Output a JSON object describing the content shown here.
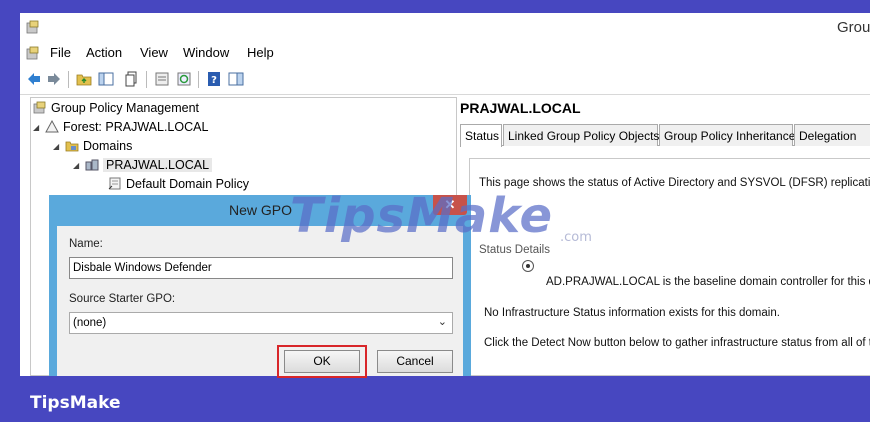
{
  "window": {
    "title": "Grou"
  },
  "menu": [
    "File",
    "Action",
    "View",
    "Window",
    "Help"
  ],
  "tree": {
    "root": "Group Policy Management",
    "forest": "Forest: PRAJWAL.LOCAL",
    "domains": "Domains",
    "domain": "PRAJWAL.LOCAL",
    "policy": "Default Domain Policy"
  },
  "right_pane": {
    "title": "PRAJWAL.LOCAL",
    "tabs": [
      "Status",
      "Linked Group Policy Objects",
      "Group Policy Inheritance",
      "Delegation"
    ],
    "intro": "This page shows the status of Active Directory and SYSVOL (DFSR) replicatio",
    "details_label": "Status Details",
    "baseline": "AD.PRAJWAL.LOCAL is the baseline domain controller for this d",
    "no_info": "No Infrastructure Status information exists for this domain.",
    "detect_now": "Click the Detect Now button below to gather infrastructure status from all of th"
  },
  "dialog": {
    "title": "New GPO",
    "close": "✕",
    "name_label": "Name:",
    "name_value": "Disbale Windows Defender",
    "starter_label": "Source Starter GPO:",
    "starter_value": "(none)",
    "ok": "OK",
    "cancel": "Cancel"
  },
  "watermark": {
    "text": "TipsMake",
    "sub": ".com"
  },
  "brand": "TipsMake",
  "colors": {
    "frame": "#4747c0",
    "dialog_border": "#5aa9dc",
    "highlight": "#d8262a",
    "close": "#c7524a"
  }
}
